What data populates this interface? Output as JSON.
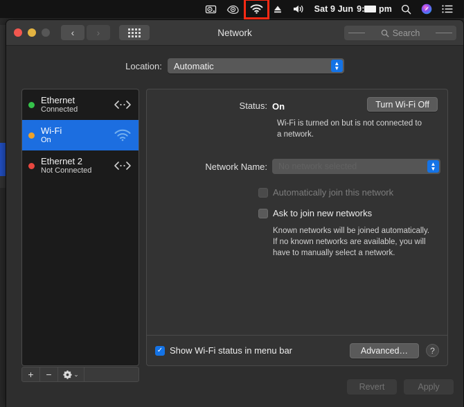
{
  "menubar": {
    "icons": [
      {
        "name": "harddisk-icon",
        "glyph": "hdd"
      },
      {
        "name": "nvidia-eye-icon",
        "glyph": "eye"
      },
      {
        "name": "wifi-menu-icon",
        "glyph": "wifi",
        "highlighted": true
      },
      {
        "name": "eject-icon",
        "glyph": "eject"
      },
      {
        "name": "volume-icon",
        "glyph": "volume"
      }
    ],
    "clock_date": "Sat 9 Jun",
    "clock_hour": "9:",
    "clock_minutes_redacted": true,
    "clock_meridiem": "pm",
    "search_icon": "search-icon",
    "siri_icon": "siri-icon",
    "controlcenter_icon": "notification-center-icon",
    "highlight_color": "#fc2a14"
  },
  "window": {
    "title": "Network",
    "traffic_lights": [
      "close",
      "minimize",
      "zoom"
    ],
    "back_label": "‹",
    "forward_label": "›",
    "grid_label": "show-all-grid",
    "search": {
      "placeholder": "Search",
      "value": ""
    }
  },
  "location": {
    "label": "Location:",
    "value": "Automatic",
    "options": [
      "Automatic"
    ]
  },
  "sidebar": {
    "services": [
      {
        "name": "Ethernet",
        "status": "Connected",
        "dot": "green",
        "dot_color": "#35c24a",
        "icon": "ethernet-icon",
        "selected": false
      },
      {
        "name": "Wi-Fi",
        "status": "On",
        "dot": "orange",
        "dot_color": "#eda22b",
        "icon": "wifi-icon",
        "selected": true
      },
      {
        "name": "Ethernet 2",
        "status": "Not Connected",
        "dot": "red",
        "dot_color": "#e8473f",
        "icon": "ethernet-icon",
        "selected": false
      }
    ],
    "toolbar": {
      "add_label": "+",
      "remove_label": "−",
      "gear_label": "gear-icon",
      "gear_chevron": "⌄"
    }
  },
  "main": {
    "status_label": "Status:",
    "status_value": "On",
    "status_description": "Wi-Fi is turned on but is not connected to a network.",
    "toggle_wifi_label": "Turn Wi-Fi Off",
    "network_name_label": "Network Name:",
    "network_name_placeholder": "No network selected",
    "network_name_value": "",
    "auto_join": {
      "label": "Automatically join this network",
      "checked": false,
      "enabled": false
    },
    "ask_join": {
      "label": "Ask to join new networks",
      "checked": false,
      "enabled": true
    },
    "known_networks_description": "Known networks will be joined automatically. If no known networks are available, you will have to manually select a network.",
    "show_status": {
      "label": "Show Wi-Fi status in menu bar",
      "checked": true
    },
    "advanced_label": "Advanced…",
    "help_label": "?"
  },
  "footer": {
    "revert_label": "Revert",
    "apply_label": "Apply",
    "revert_enabled": false,
    "apply_enabled": false
  },
  "colors": {
    "accent_blue": "#1c6ee0",
    "window_bg": "#2e2e2e",
    "sidebar_bg": "#1b1b1b",
    "pane_bg": "#333333"
  }
}
